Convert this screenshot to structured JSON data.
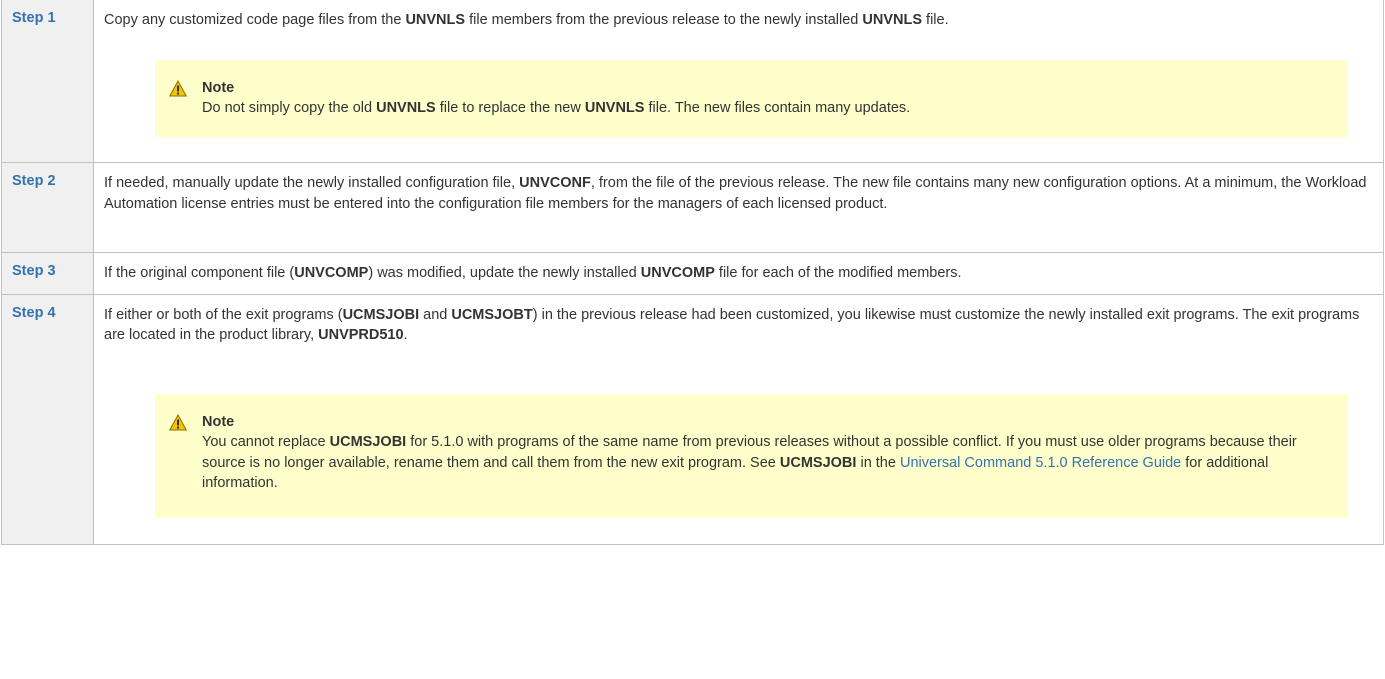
{
  "steps": [
    {
      "label": "Step 1",
      "pre": "Copy any customized code page files from the ",
      "b1": "UNVNLS",
      "mid": " file members from the previous release to the newly installed ",
      "b2": "UNVNLS",
      "post": " file.",
      "note": {
        "title": "Note",
        "pre": "Do not simply copy the old ",
        "b1": "UNVNLS",
        "mid": " file to replace the new ",
        "b2": "UNVNLS",
        "post": " file. The new files contain many updates."
      }
    },
    {
      "label": "Step 2",
      "pre": "If needed, manually update the newly installed configuration file, ",
      "b1": "UNVCONF",
      "post": ", from the file of the previous release. The new file contains many new configuration options. At a minimum, the Workload Automation license entries must be entered into the configuration file members for the managers of each licensed product."
    },
    {
      "label": "Step 3",
      "pre": "If the original component file (",
      "b1": "UNVCOMP",
      "mid": ") was modified, update the newly installed ",
      "b2": "UNVCOMP",
      "post": " file for each of the modified members."
    },
    {
      "label": "Step 4",
      "pre": "If either or both of the exit programs (",
      "b1": "UCMSJOBI",
      "mid": " and ",
      "b2": "UCMSJOBT",
      "mid2": ") in the previous release had been customized, you likewise must customize the newly installed exit programs. The exit programs are located in the product library, ",
      "b3": "UNVPRD510",
      "post": ".",
      "note": {
        "title": "Note",
        "pre": "You cannot replace ",
        "b1": "UCMSJOBI",
        "mid": " for 5.1.0 with programs of the same name from previous releases without a possible conflict. If you must use older programs because their source is no longer available, rename them and call them from the new exit program. See ",
        "b2": "UCMSJOBI",
        "mid2": " in the ",
        "link": "Universal Command 5.1.0 Reference Guide",
        "post": " for additional information."
      }
    }
  ],
  "icons": {
    "warning": "warning-triangle-icon"
  },
  "colors": {
    "step_label": "#3572b0",
    "note_bg": "#ffffcc",
    "label_bg": "#f0f0f0",
    "link": "#3572b0"
  }
}
